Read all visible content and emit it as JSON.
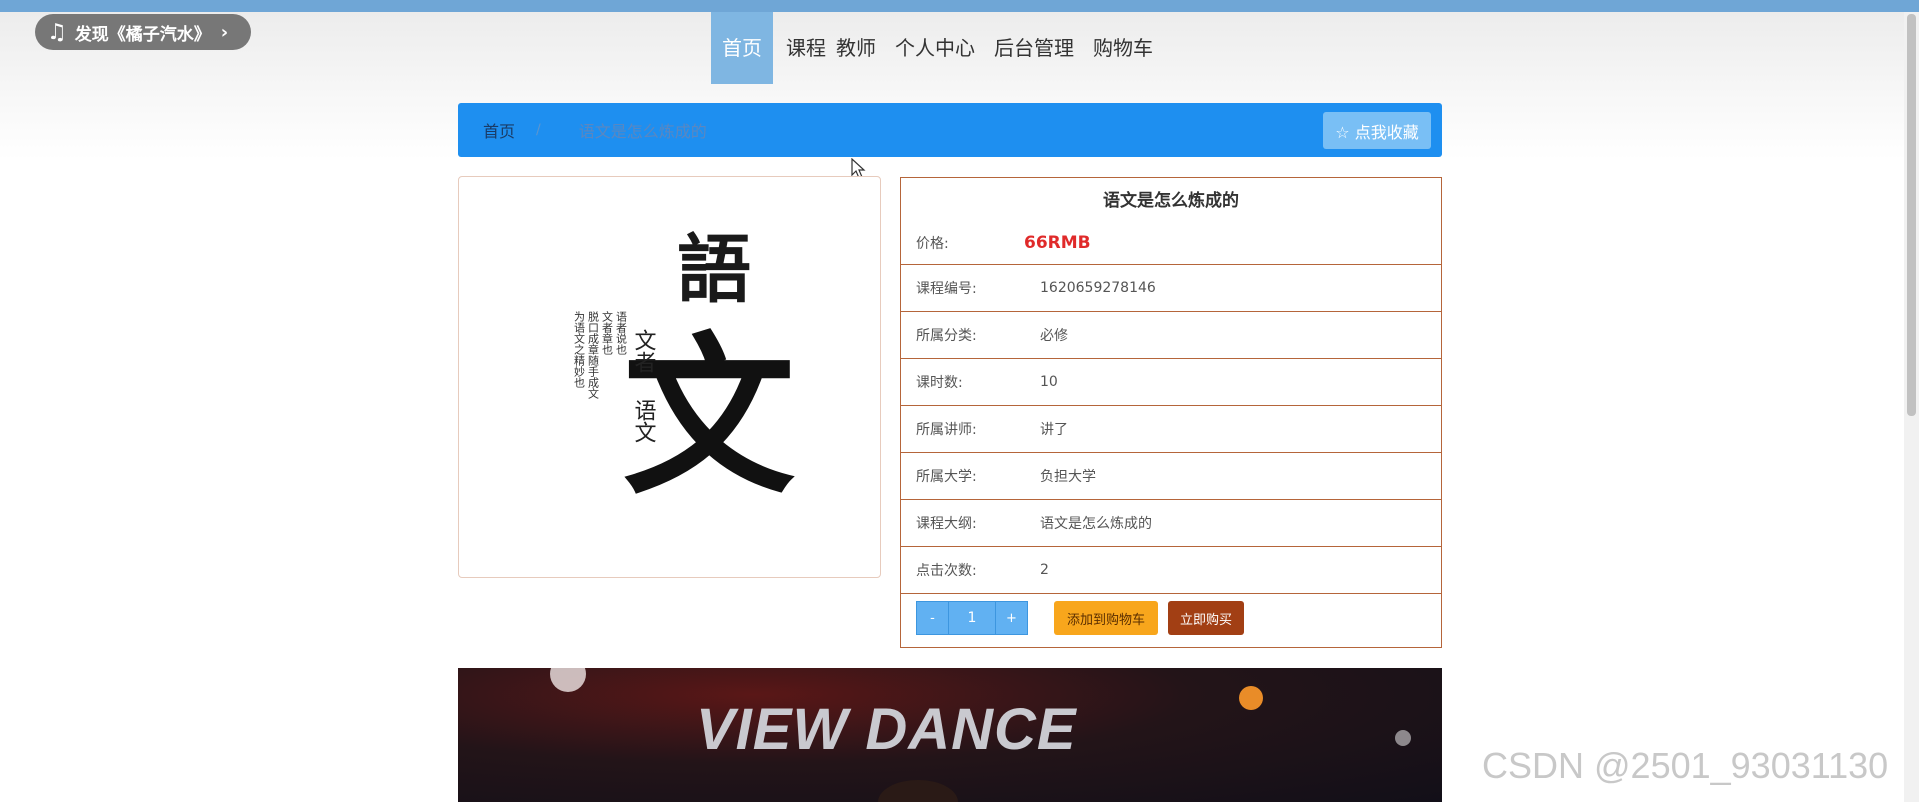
{
  "music": {
    "label": "发现《橘子汽水》"
  },
  "nav": {
    "items": [
      "首页",
      "课程",
      "教师",
      "个人中心",
      "后台管理",
      "购物车"
    ]
  },
  "breadcrumb": {
    "home": "首页",
    "separator": "/",
    "current": "语文是怎么炼成的"
  },
  "favorite": {
    "label": "☆ 点我收藏"
  },
  "course_image": {
    "big_1": "語",
    "big_2": "文",
    "small_1": "文者",
    "small_2": "语文",
    "poem_1": "语者说也",
    "poem_2": "文者章也",
    "poem_3": "脱口成章随手成文",
    "poem_4": "为语文之精妙也"
  },
  "detail": {
    "title": "语文是怎么炼成的",
    "price_label": "价格:",
    "price_value": "66RMB",
    "rows": [
      {
        "label": "课程编号:",
        "value": "1620659278146"
      },
      {
        "label": "所属分类:",
        "value": "必修"
      },
      {
        "label": "课时数:",
        "value": "10"
      },
      {
        "label": "所属讲师:",
        "value": "讲了"
      },
      {
        "label": "所属大学:",
        "value": "负担大学"
      },
      {
        "label": "课程大纲:",
        "value": "语文是怎么炼成的"
      },
      {
        "label": "点击次数:",
        "value": "2"
      }
    ],
    "minus": "-",
    "quantity": "1",
    "plus": "+",
    "add_cart": "添加到购物车",
    "buy_now": "立即购买"
  },
  "video": {
    "text": "VIEW DANCE"
  },
  "watermark": "CSDN @2501_93031130",
  "colors": {
    "nav_active": "#7fb6e2",
    "breadcrumb": "#1e8ff0",
    "price": "#e02a2a",
    "add_cart": "#f8a61c",
    "buy_now": "#a23f14",
    "border": "#b5653a"
  }
}
